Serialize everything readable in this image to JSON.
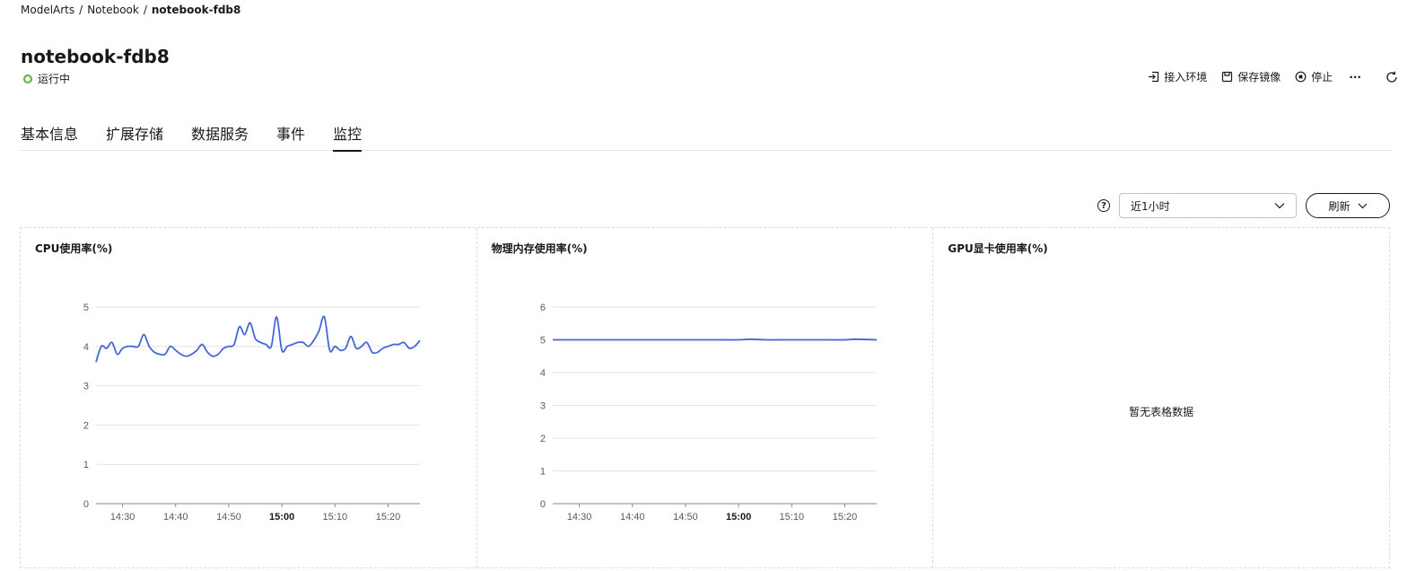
{
  "breadcrumb": {
    "root": "ModelArts",
    "sep": "/",
    "middle": "Notebook",
    "current": "notebook-fdb8"
  },
  "header": {
    "title": "notebook-fdb8",
    "status": "运行中",
    "status_color": "#5ab339"
  },
  "actions": {
    "connect": "接入环境",
    "save_image": "保存镜像",
    "stop": "停止",
    "more": "···"
  },
  "tabs": [
    "基本信息",
    "扩展存储",
    "数据服务",
    "事件",
    "监控"
  ],
  "active_tab": "监控",
  "toolbar": {
    "time_range": "近1小时",
    "refresh": "刷新"
  },
  "panels": {
    "cpu": {
      "title": "CPU使用率(%)"
    },
    "mem": {
      "title": "物理内存使用率(%)"
    },
    "gpu": {
      "title": "GPU显卡使用率(%)",
      "empty": "暂无表格数据"
    }
  },
  "chart_data": [
    {
      "type": "line",
      "title": "CPU使用率(%)",
      "ylim": [
        0,
        5
      ],
      "yticks": [
        0,
        1,
        2,
        3,
        4,
        5
      ],
      "xlim": [
        25,
        86
      ],
      "xticks": [
        30,
        40,
        50,
        60,
        70,
        80
      ],
      "xtick_labels": [
        "14:30",
        "14:40",
        "14:50",
        "15:00",
        "15:10",
        "15:20"
      ],
      "bold_tick": "15:00",
      "color": "#4566d8",
      "x": [
        25,
        26,
        27,
        28,
        29,
        30,
        31,
        32,
        33,
        34,
        35,
        36,
        37,
        38,
        39,
        40,
        41,
        42,
        43,
        44,
        45,
        46,
        47,
        48,
        49,
        50,
        51,
        52,
        53,
        54,
        55,
        56,
        57,
        58,
        59,
        60,
        61,
        62,
        63,
        64,
        65,
        66,
        67,
        68,
        69,
        70,
        71,
        72,
        73,
        74,
        75,
        76,
        77,
        78,
        79,
        80,
        81,
        82,
        83,
        84,
        85,
        86
      ],
      "y": [
        3.6,
        4.0,
        3.95,
        4.1,
        3.8,
        3.95,
        4.0,
        4.0,
        4.0,
        4.3,
        4.0,
        3.85,
        3.8,
        3.8,
        4.0,
        3.9,
        3.8,
        3.75,
        3.8,
        3.9,
        4.05,
        3.85,
        3.75,
        3.8,
        3.95,
        4.0,
        4.05,
        4.5,
        4.3,
        4.6,
        4.2,
        4.1,
        4.05,
        4.0,
        4.75,
        3.9,
        4.0,
        4.05,
        4.1,
        4.1,
        4.0,
        4.15,
        4.4,
        4.75,
        3.9,
        4.0,
        3.9,
        3.95,
        4.25,
        3.95,
        4.0,
        4.1,
        3.85,
        3.85,
        3.95,
        4.0,
        4.05,
        4.05,
        4.1,
        3.95,
        4.0,
        4.15
      ]
    },
    {
      "type": "line",
      "title": "物理内存使用率(%)",
      "ylim": [
        0,
        6
      ],
      "yticks": [
        0,
        1,
        2,
        3,
        4,
        5,
        6
      ],
      "xlim": [
        25,
        86
      ],
      "xticks": [
        30,
        40,
        50,
        60,
        70,
        80
      ],
      "xtick_labels": [
        "14:30",
        "14:40",
        "14:50",
        "15:00",
        "15:10",
        "15:20"
      ],
      "bold_tick": "15:00",
      "color": "#4566d8",
      "x": [
        25,
        30,
        35,
        40,
        45,
        50,
        55,
        60,
        62,
        65,
        70,
        75,
        80,
        82,
        86
      ],
      "y": [
        5.0,
        5.0,
        5.0,
        5.0,
        5.0,
        5.0,
        5.0,
        5.0,
        5.02,
        5.0,
        5.0,
        5.0,
        5.0,
        5.02,
        5.0
      ]
    }
  ]
}
